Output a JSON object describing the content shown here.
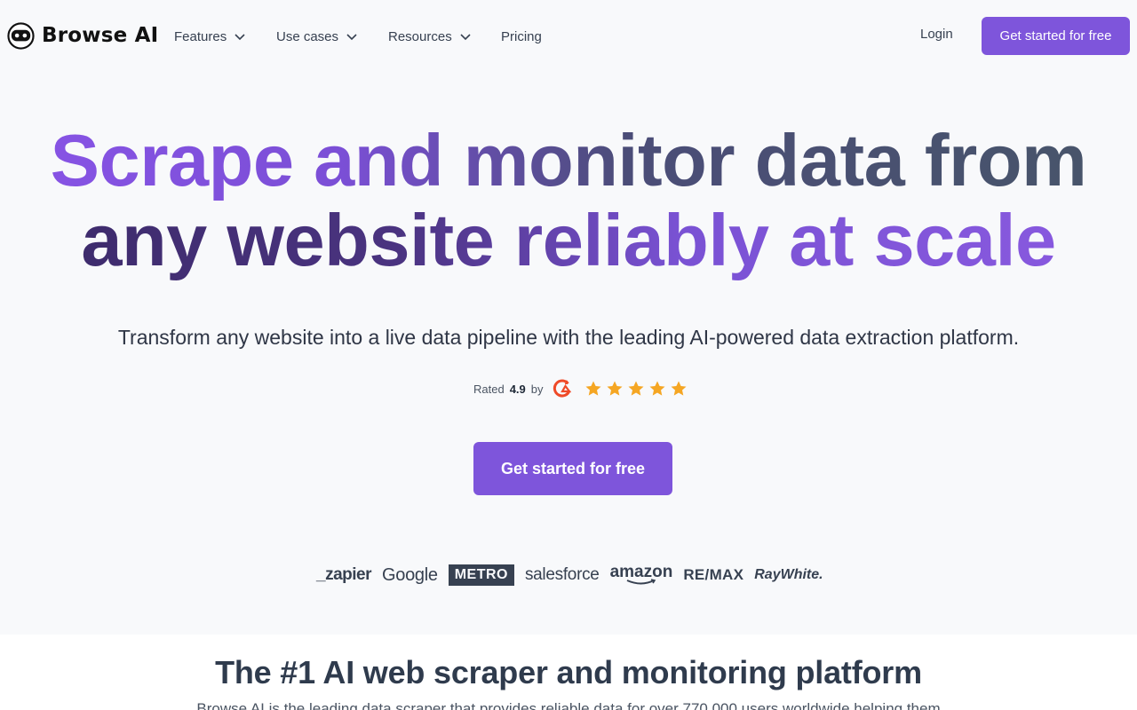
{
  "brand": {
    "name": "Browse AI",
    "logo_icon": "robot-face-icon"
  },
  "nav": {
    "items": [
      {
        "label": "Features",
        "has_dropdown": true
      },
      {
        "label": "Use cases",
        "has_dropdown": true
      },
      {
        "label": "Resources",
        "has_dropdown": true
      },
      {
        "label": "Pricing",
        "has_dropdown": false
      }
    ],
    "login_label": "Login",
    "cta_label": "Get started for free"
  },
  "hero": {
    "title_line1": "Scrape and monitor data from",
    "title_line2": "any website reliably at scale",
    "subtitle": "Transform any website into a live data pipeline with the leading AI-powered data extraction platform.",
    "rating_prefix": "Rated",
    "rating_value": "4.9",
    "rating_suffix": "by",
    "rating_source_icon": "g2-icon",
    "stars": 5,
    "cta_label": "Get started for free"
  },
  "customer_logos": [
    "_zapier",
    "Google",
    "METRO",
    "salesforce",
    "amazon",
    "RE/MAX",
    "RayWhite."
  ],
  "section2": {
    "title": "The #1 AI web scraper and monitoring platform",
    "subtitle": "Browse AI is the leading data scraper that provides reliable data for over 770,000 users worldwide helping them"
  },
  "colors": {
    "accent": "#7e55db",
    "background": "#f8f9fb",
    "star": "#f5a623",
    "g2": "#ef4a28"
  }
}
